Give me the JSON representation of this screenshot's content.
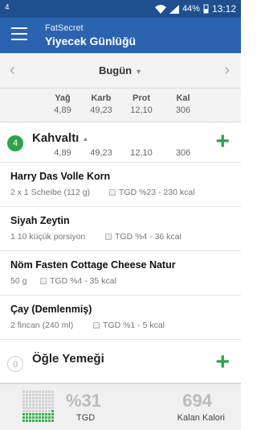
{
  "status_bar": {
    "left_icon": "4",
    "battery": "44%",
    "time": "13:12"
  },
  "app_bar": {
    "brand": "FatSecret",
    "title": "Yiyecek Günlüğü"
  },
  "date_bar": {
    "date": "Bugün"
  },
  "totals": {
    "labels": [
      "Yağ",
      "Karb",
      "Prot",
      "Kal"
    ],
    "values": [
      "4,89",
      "49,23",
      "12,10",
      "306"
    ]
  },
  "meals": [
    {
      "name": "Kahvaltı",
      "count": "4",
      "values": [
        "4,89",
        "49,23",
        "12,10",
        "306"
      ],
      "items": [
        {
          "name": "Harry Das Volle Korn",
          "detail": "2  x 1 Scheibe (112 g)",
          "tgd": "TGD %23 - 230 kcal"
        },
        {
          "name": "Siyah Zeytin",
          "detail": "1  10 küçük porsiyon",
          "tgd": "TGD %4 - 36 kcal"
        },
        {
          "name": "Nöm Fasten Cottage Cheese Natur",
          "detail": "50  g",
          "tgd": "TGD %4 - 35 kcal"
        },
        {
          "name": "Çay (Demlenmiş)",
          "detail": "2  fincan (240 ml)",
          "tgd": "TGD %1 - 5 kcal"
        }
      ]
    },
    {
      "name": "Öğle Yemeği",
      "count": "0"
    }
  ],
  "footer": {
    "tgd_percent": "%31",
    "tgd_label": "TGD",
    "remaining": "694",
    "remaining_label": "Kalan Kalori",
    "progress_fraction": 0.31
  },
  "colors": {
    "appbar": "#2a63b0",
    "statusbar": "#1f4f8f",
    "accent_green": "#2ea44a"
  },
  "icons": [
    "menu-icon",
    "wifi-icon",
    "signal-icon",
    "battery-icon",
    "chevron-left-icon",
    "chevron-right-icon",
    "add-icon",
    "progress-grid-icon"
  ]
}
